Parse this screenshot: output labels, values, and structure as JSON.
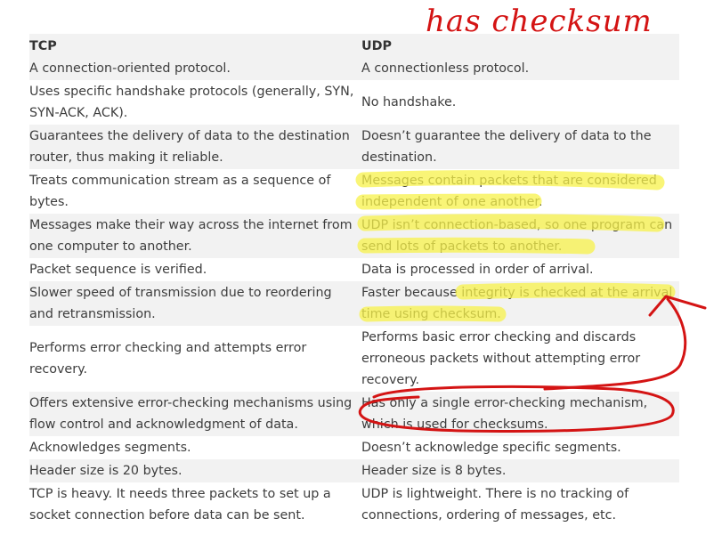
{
  "table": {
    "headers": [
      "TCP",
      "UDP"
    ],
    "rows": [
      {
        "tcp": "A connection-oriented protocol.",
        "udp": "A connectionless protocol."
      },
      {
        "tcp": "Uses specific handshake protocols (generally, SYN, SYN-ACK, ACK).",
        "udp": "No handshake."
      },
      {
        "tcp": "Guarantees the delivery of data to the destination router, thus making it reliable.",
        "udp": "Doesn’t guarantee the delivery of data to the destination."
      },
      {
        "tcp": "Treats communication stream as a sequence of bytes.",
        "udp": "Messages contain packets that are considered independent of one another."
      },
      {
        "tcp": "Messages make their way across the internet from one computer to another.",
        "udp": "UDP isn’t connection-based, so one program can send lots of packets to another."
      },
      {
        "tcp": "Packet sequence is verified.",
        "udp": "Data is processed in order of arrival."
      },
      {
        "tcp": "Slower speed of transmission due to reordering and retransmission.",
        "udp": "Faster because integrity is checked at the arrival time using checksum."
      },
      {
        "tcp": "Performs error checking and attempts error recovery.",
        "udp": "Performs basic error checking and discards erroneous packets without attempting error recovery."
      },
      {
        "tcp": "Offers extensive error-checking mechanisms using flow control and acknowledgment of data.",
        "udp": "Has only a single error-checking mechanism, which is used for checksums."
      },
      {
        "tcp": "Acknowledges segments.",
        "udp": "Doesn’t acknowledge specific segments."
      },
      {
        "tcp": "Header size is 20 bytes.",
        "udp": "Header size is 8 bytes."
      },
      {
        "tcp": "TCP is heavy. It needs three packets to set up a socket connection before data can be sent.",
        "udp": "UDP is lightweight. There is no tracking of connections, ordering of messages, etc."
      }
    ]
  },
  "annotation": {
    "handwritten_note": "has checksum",
    "highlight_color": "#f7f24a",
    "ink_color": "#d41414"
  }
}
